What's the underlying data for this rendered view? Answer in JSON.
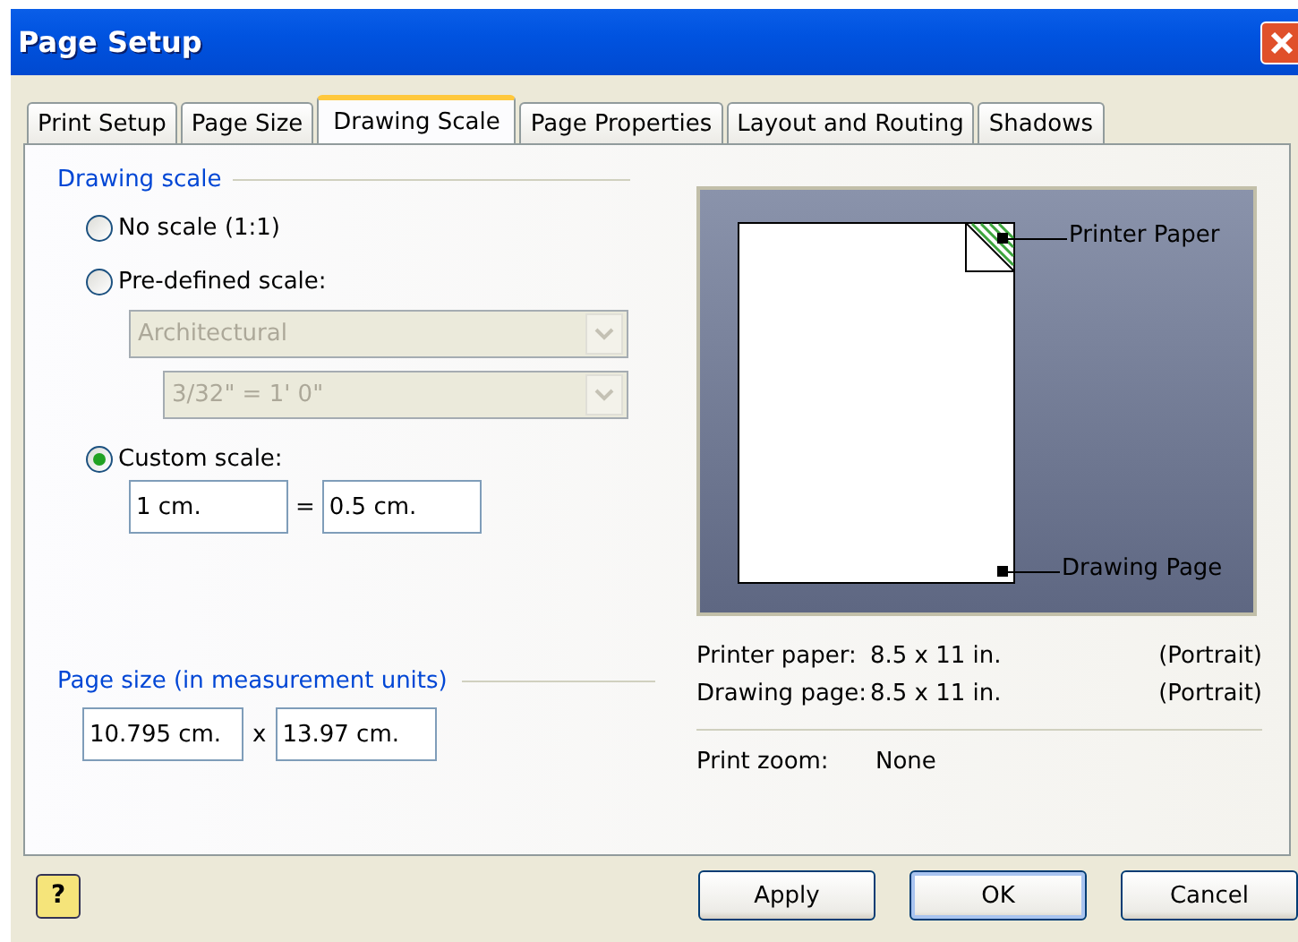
{
  "window": {
    "title": "Page Setup"
  },
  "tabs": [
    {
      "label": "Print Setup",
      "selected": false
    },
    {
      "label": "Page Size",
      "selected": false
    },
    {
      "label": "Drawing Scale",
      "selected": true
    },
    {
      "label": "Page Properties",
      "selected": false
    },
    {
      "label": "Layout and Routing",
      "selected": false
    },
    {
      "label": "Shadows",
      "selected": false
    }
  ],
  "drawing_scale": {
    "heading": "Drawing scale",
    "options": [
      {
        "label": "No scale (1:1)",
        "selected": false
      },
      {
        "label": "Pre-defined scale:",
        "selected": false
      },
      {
        "label": "Custom scale:",
        "selected": true
      }
    ],
    "predefined_dropdowns": [
      {
        "value": "Architectural",
        "disabled": true
      },
      {
        "value": "3/32\" = 1' 0\"",
        "disabled": true
      }
    ],
    "custom_left": "1 cm.",
    "equals": "=",
    "custom_right": "0.5 cm."
  },
  "page_size": {
    "heading": "Page size (in measurement units)",
    "width": "10.795 cm.",
    "separator": "x",
    "height": "13.97 cm."
  },
  "preview": {
    "printer_paper_label": "Printer Paper",
    "drawing_page_label": "Drawing Page"
  },
  "info": [
    {
      "label": "Printer paper:",
      "value": "8.5 x 11 in.",
      "orientation": "(Portrait)"
    },
    {
      "label": "Drawing page:",
      "value": "8.5 x 11 in.",
      "orientation": "(Portrait)"
    }
  ],
  "print_zoom": {
    "label": "Print zoom:",
    "value": "None"
  },
  "help_button": "?",
  "buttons": [
    {
      "label": "Apply",
      "default": false
    },
    {
      "label": "OK",
      "default": true
    },
    {
      "label": "Cancel",
      "default": false
    }
  ]
}
